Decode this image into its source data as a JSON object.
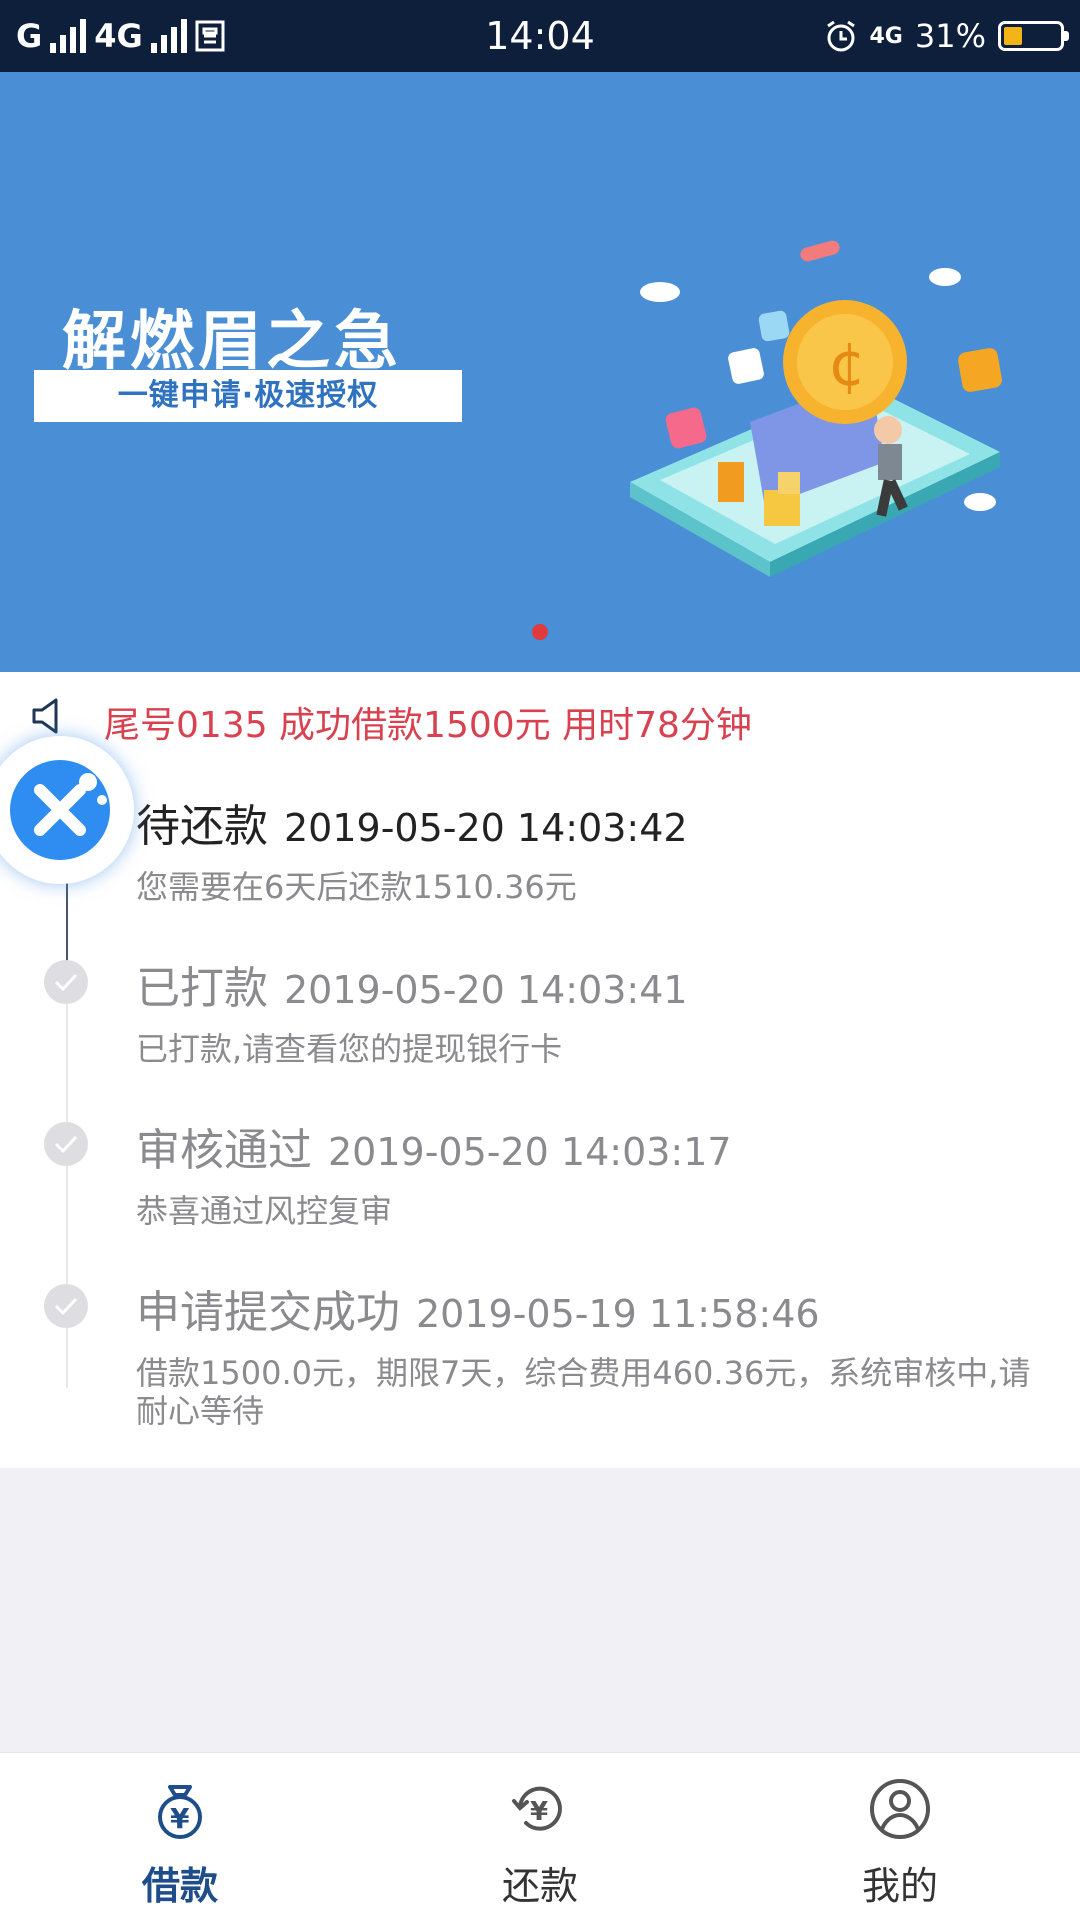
{
  "status_bar": {
    "carrier1": "G",
    "carrier2": "4G",
    "time": "14:04",
    "network": "4G",
    "battery": "31%",
    "battery_level": 0.31,
    "battery_color": "#f2b417"
  },
  "banner": {
    "title": "解燃眉之急",
    "subtitle": "一键申请·极速授权",
    "page_indicator_color": "#e23b3b"
  },
  "notice": {
    "text": "尾号0135 成功借款1500元 用时78分钟",
    "color": "#d84250"
  },
  "timeline": [
    {
      "name": "待还款",
      "time": "2019-05-20 14:03:42",
      "desc": "您需要在6天后还款1510.36元",
      "state": "active"
    },
    {
      "name": "已打款",
      "time": "2019-05-20 14:03:41",
      "desc": "已打款,请查看您的提现银行卡",
      "state": "done"
    },
    {
      "name": "审核通过",
      "time": "2019-05-20 14:03:17",
      "desc": "恭喜通过风控复审",
      "state": "done"
    },
    {
      "name": "申请提交成功",
      "time": "2019-05-19 11:58:46",
      "desc": "借款1500.0元，期限7天，综合费用460.36元，系统审核中,请耐心等待",
      "state": "done"
    }
  ],
  "tabs": [
    {
      "label": "借款",
      "icon": "money-bag-icon",
      "active": true
    },
    {
      "label": "还款",
      "icon": "repay-icon",
      "active": false
    },
    {
      "label": "我的",
      "icon": "user-icon",
      "active": false
    }
  ],
  "colors": {
    "accent": "#1f4d8a",
    "banner_bg": "#4a8fd6",
    "status_bg": "#0e1f3c"
  }
}
